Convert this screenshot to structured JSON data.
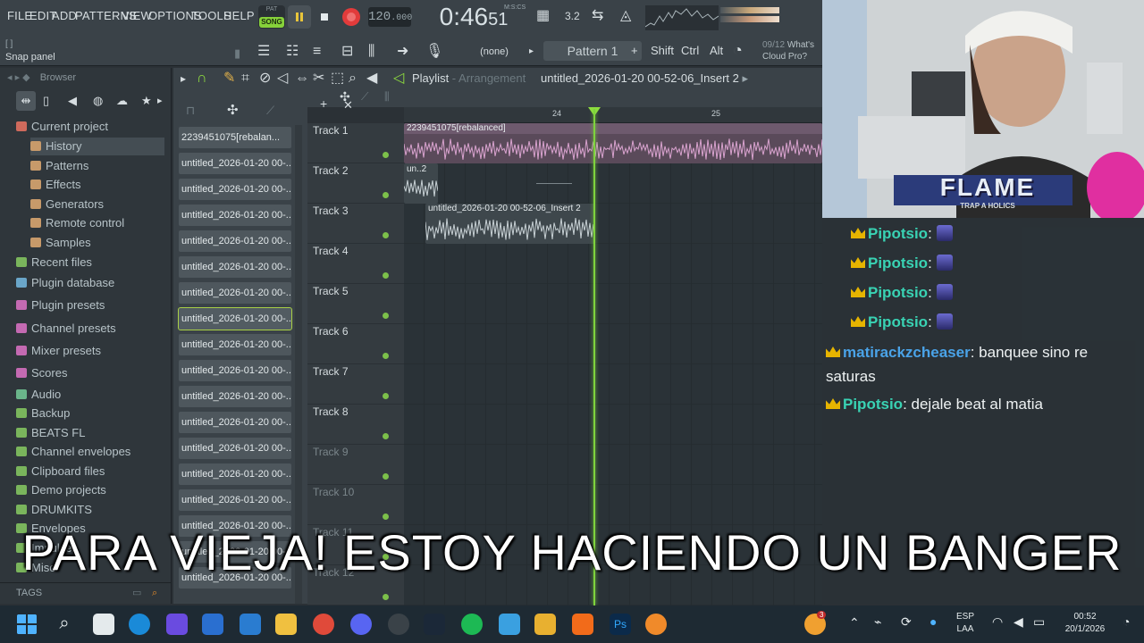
{
  "menu": [
    "FILE",
    "EDIT",
    "ADD",
    "PATTERNS",
    "VIEW",
    "OPTIONS",
    "TOOLS",
    "HELP"
  ],
  "transport": {
    "pat_label": "PAT",
    "song_label": "SONG",
    "tempo_int": "120",
    "tempo_dec": ".000",
    "time_main": "0:46",
    "time_sub": "51",
    "time_unit": "M:S:CS"
  },
  "snap": {
    "box": "[ ]",
    "label": "Snap panel"
  },
  "toolbar": {
    "channel_sel": "(none)",
    "pattern": "Pattern 1",
    "plus": "+",
    "keys": [
      "Shift",
      "Ctrl",
      "Alt"
    ],
    "cloud_date": "09/12",
    "cloud_text1": "What's",
    "cloud_text2": "Cloud Pro?"
  },
  "browser": {
    "title": "Browser",
    "items": [
      {
        "label": "Current project",
        "color": "#cf6a5c"
      },
      {
        "label": "History",
        "color": "#c79a6a"
      },
      {
        "label": "Patterns",
        "color": "#c79a6a"
      },
      {
        "label": "Effects",
        "color": "#c79a6a"
      },
      {
        "label": "Generators",
        "color": "#c79a6a"
      },
      {
        "label": "Remote control",
        "color": "#c79a6a"
      },
      {
        "label": "Samples",
        "color": "#c79a6a"
      },
      {
        "label": "Recent files",
        "color": "#7ab55c"
      },
      {
        "label": "Plugin database",
        "color": "#6aa6c9"
      },
      {
        "label": "Plugin presets",
        "color": "#c46ab2"
      },
      {
        "label": "Channel presets",
        "color": "#c46ab2"
      },
      {
        "label": "Mixer presets",
        "color": "#c46ab2"
      },
      {
        "label": "Scores",
        "color": "#c46ab2"
      },
      {
        "label": "Audio",
        "color": "#6ab58a"
      },
      {
        "label": "Backup",
        "color": "#7ab55c"
      },
      {
        "label": "BEATS FL",
        "color": "#7ab55c"
      },
      {
        "label": "Channel envelopes",
        "color": "#7ab55c"
      },
      {
        "label": "Clipboard files",
        "color": "#7ab55c"
      },
      {
        "label": "Demo projects",
        "color": "#7ab55c"
      },
      {
        "label": "DRUMKITS",
        "color": "#7ab55c"
      },
      {
        "label": "Envelopes",
        "color": "#7ab55c"
      },
      {
        "label": "Impulses",
        "color": "#7ab55c"
      },
      {
        "label": "Misc",
        "color": "#7ab55c"
      }
    ],
    "tags": "TAGS"
  },
  "picker": {
    "clips": [
      "2239451075[rebalan...",
      "untitled_2026-01-20 00-...",
      "untitled_2026-01-20 00-...",
      "untitled_2026-01-20 00-...",
      "untitled_2026-01-20 00-...",
      "untitled_2026-01-20 00-...",
      "untitled_2026-01-20 00-...",
      "untitled_2026-01-20 00-...",
      "untitled_2026-01-20 00-...",
      "untitled_2026-01-20 00-...",
      "untitled_2026-01-20 00-...",
      "untitled_2026-01-20 00-...",
      "untitled_2026-01-20 00-...",
      "untitled_2026-01-20 00-...",
      "untitled_2026-01-20 00-...",
      "untitled_2026-01-20 00-...",
      "untitled_2026-01-20 00-...",
      "untitled_2026-01-20 00-..."
    ],
    "selected_index": 7
  },
  "playlist": {
    "title": "Playlist",
    "sep": " - ",
    "mode": "Arrangement",
    "file": "untitled_2026-01-20 00-52-06_Insert 2",
    "bars": [
      "24",
      "25"
    ],
    "tracks": [
      "Track 1",
      "Track 2",
      "Track 3",
      "Track 4",
      "Track 5",
      "Track 6",
      "Track 7",
      "Track 8",
      "Track 9",
      "Track 10",
      "Track 11",
      "Track 12"
    ],
    "clip1": "2239451075[rebalanced]",
    "clip2": "un..2",
    "clip3": "untitled_2026-01-20 00-52-06_Insert 2"
  },
  "stream": {
    "overlay_title": "FLAME",
    "overlay_sub": "TRAP A HOLICS",
    "chat": [
      {
        "user": "Pipotsio",
        "color": "#39d3b4",
        "text": ": ",
        "emote": true
      },
      {
        "user": "Pipotsio",
        "color": "#39d3b4",
        "text": ": ",
        "emote": true
      },
      {
        "user": "Pipotsio",
        "color": "#39d3b4",
        "text": ": ",
        "emote": true
      },
      {
        "user": "Pipotsio",
        "color": "#39d3b4",
        "text": ": ",
        "emote": true
      },
      {
        "user": "matirackzcheaser",
        "color": "#4aa3e8",
        "text": ": banquee sino re saturas",
        "emote": false
      },
      {
        "user": "Pipotsio",
        "color": "#39d3b4",
        "text": ": dejale beat al matia",
        "emote": false
      }
    ],
    "subtitle": "PARA VIEJA! ESTOY HACIENDO UN BANGER"
  },
  "taskbar": {
    "lang1": "ESP",
    "lang2": "LAA",
    "time": "00:52",
    "date": "20/1/2026",
    "notif": "3"
  }
}
